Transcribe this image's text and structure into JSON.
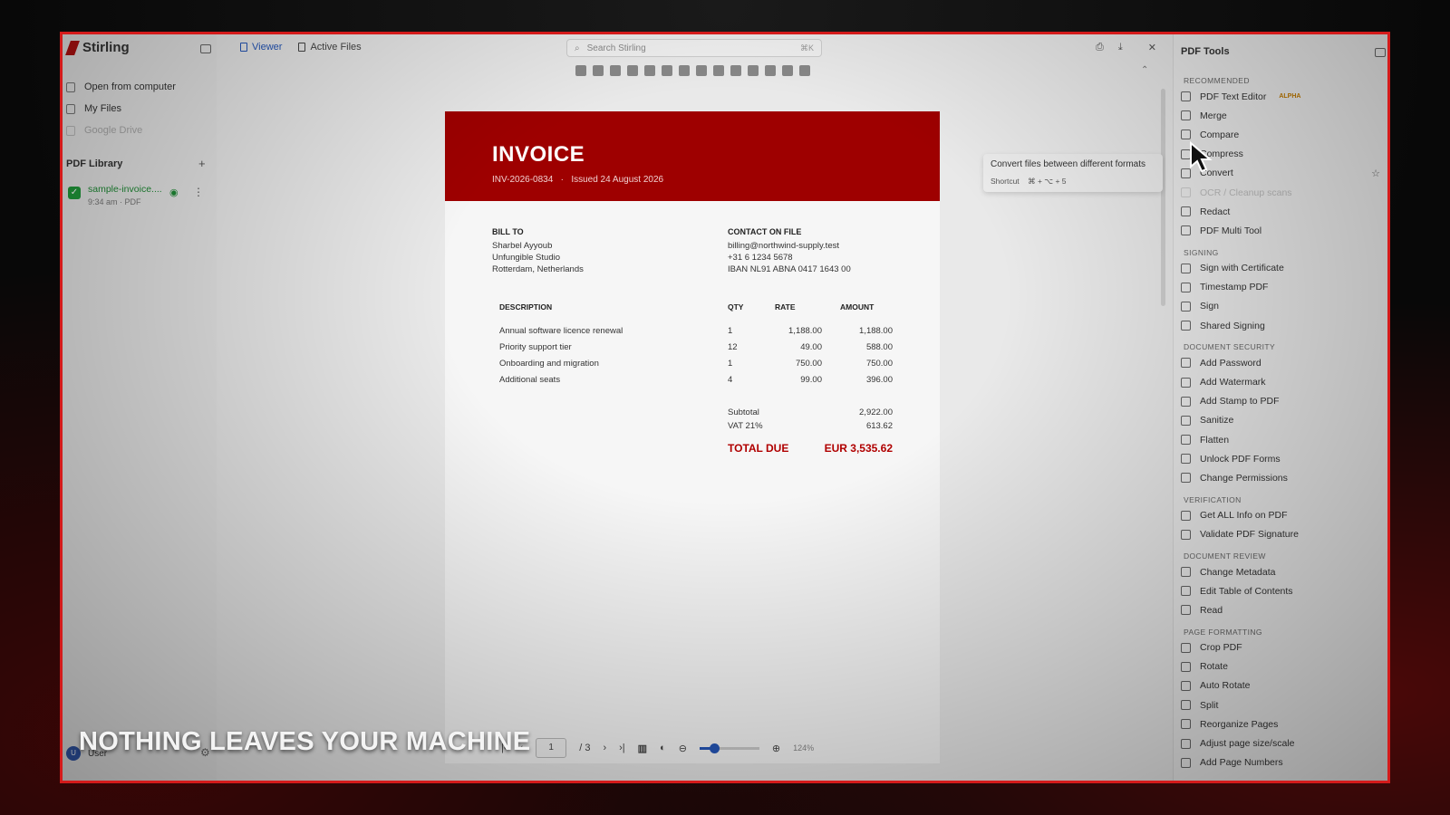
{
  "app": {
    "brand": "Stirling",
    "tabs": [
      {
        "label": "Viewer",
        "active": true
      },
      {
        "label": "Active Files",
        "active": false
      }
    ],
    "search": {
      "placeholder": "Search Stirling",
      "shortcut": "⌘K"
    }
  },
  "left_nav": {
    "items": [
      {
        "label": "Open from computer"
      },
      {
        "label": "My Files"
      },
      {
        "label": "Google Drive"
      }
    ],
    "library_title": "PDF Library",
    "file": {
      "name": "sample-invoice....",
      "meta": "9:34 am · PDF"
    },
    "user": {
      "initial": "U",
      "name": "User"
    }
  },
  "invoice": {
    "title": "INVOICE",
    "number": "INV-2026-0834",
    "separator": "·",
    "issued": "Issued 24 August 2026",
    "bill_to_label": "BILL TO",
    "bill_to": [
      "Sharbel Ayyoub",
      "Unfungible Studio",
      "Rotterdam, Netherlands"
    ],
    "contact_label": "CONTACT ON FILE",
    "contact": [
      "billing@northwind-supply.test",
      "+31 6 1234 5678",
      "IBAN NL91 ABNA 0417 1643 00"
    ],
    "columns": {
      "desc": "DESCRIPTION",
      "qty": "QTY",
      "rate": "RATE",
      "amount": "AMOUNT"
    },
    "rows": [
      {
        "desc": "Annual software licence renewal",
        "qty": "1",
        "rate": "1,188.00",
        "amount": "1,188.00"
      },
      {
        "desc": "Priority support tier",
        "qty": "12",
        "rate": "49.00",
        "amount": "588.00"
      },
      {
        "desc": "Onboarding and migration",
        "qty": "1",
        "rate": "750.00",
        "amount": "750.00"
      },
      {
        "desc": "Additional seats",
        "qty": "4",
        "rate": "99.00",
        "amount": "396.00"
      }
    ],
    "subtotal_label": "Subtotal",
    "subtotal": "2,922.00",
    "vat_label": "VAT 21%",
    "vat": "613.62",
    "total_label": "TOTAL DUE",
    "total": "EUR 3,535.62"
  },
  "tooltip": {
    "text": "Convert files between different formats",
    "shortcut_label": "Shortcut",
    "shortcut_keys": "⌘ + ⌥ + 5"
  },
  "pager": {
    "page": "1",
    "total": "/ 3",
    "zoom": "124%",
    "zoom_level": 0.25
  },
  "tools_panel": {
    "title": "PDF Tools",
    "sections": [
      {
        "name": "RECOMMENDED",
        "tools": [
          {
            "label": "PDF Text Editor",
            "badge": "ALPHA"
          },
          {
            "label": "Merge"
          },
          {
            "label": "Compare"
          },
          {
            "label": "Compress"
          },
          {
            "label": "Convert",
            "star": "☆"
          },
          {
            "label": "OCR / Cleanup scans",
            "dim": true
          },
          {
            "label": "Redact"
          },
          {
            "label": "PDF Multi Tool"
          }
        ]
      },
      {
        "name": "SIGNING",
        "tools": [
          {
            "label": "Sign with Certificate"
          },
          {
            "label": "Timestamp PDF"
          },
          {
            "label": "Sign"
          },
          {
            "label": "Shared Signing"
          }
        ]
      },
      {
        "name": "DOCUMENT SECURITY",
        "tools": [
          {
            "label": "Add Password"
          },
          {
            "label": "Add Watermark"
          },
          {
            "label": "Add Stamp to PDF"
          },
          {
            "label": "Sanitize"
          },
          {
            "label": "Flatten"
          },
          {
            "label": "Unlock PDF Forms"
          },
          {
            "label": "Change Permissions"
          }
        ]
      },
      {
        "name": "VERIFICATION",
        "tools": [
          {
            "label": "Get ALL Info on PDF"
          },
          {
            "label": "Validate PDF Signature"
          }
        ]
      },
      {
        "name": "DOCUMENT REVIEW",
        "tools": [
          {
            "label": "Change Metadata"
          },
          {
            "label": "Edit Table of Contents"
          },
          {
            "label": "Read"
          }
        ]
      },
      {
        "name": "PAGE FORMATTING",
        "tools": [
          {
            "label": "Crop PDF"
          },
          {
            "label": "Rotate"
          },
          {
            "label": "Auto Rotate"
          },
          {
            "label": "Split"
          },
          {
            "label": "Reorganize Pages"
          },
          {
            "label": "Adjust page size/scale"
          },
          {
            "label": "Add Page Numbers"
          }
        ]
      }
    ]
  },
  "caption": "NOTHING LEAVES YOUR MACHINE",
  "colors": {
    "accent": "#2456b8",
    "invoice_red": "#9e0000",
    "frame_red": "#d41b1b"
  }
}
